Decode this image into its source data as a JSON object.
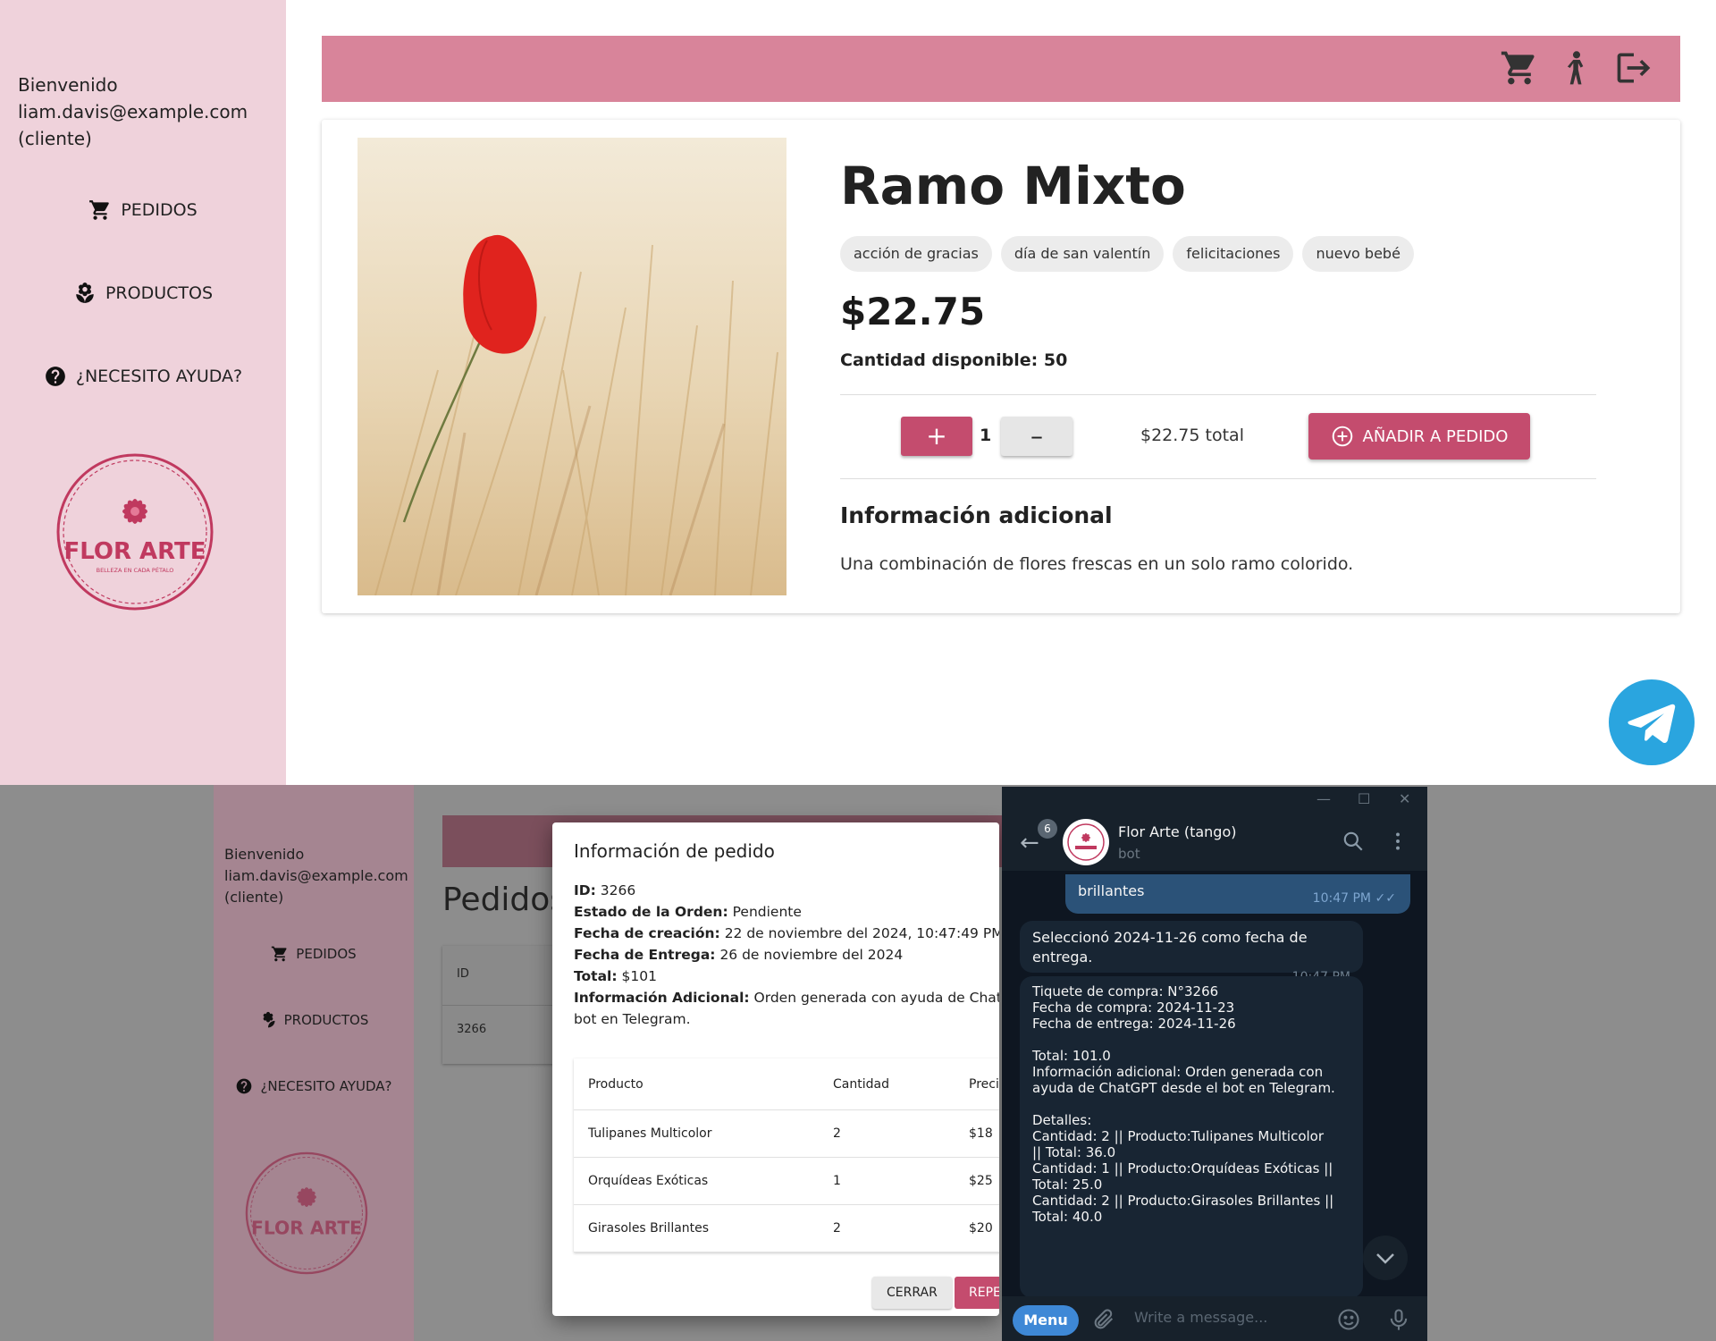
{
  "sidebar": {
    "welcome_line1": "Bienvenido",
    "welcome_email": "liam.davis@example.com",
    "welcome_role": "(cliente)",
    "items": [
      {
        "label": "PEDIDOS",
        "icon": "cart-icon"
      },
      {
        "label": "PRODUCTOS",
        "icon": "flower-icon"
      },
      {
        "label": "¿NECESITO AYUDA?",
        "icon": "help-icon"
      }
    ],
    "logo_text": "FLOR ARTE",
    "logo_tagline": "BELLEZA EN CADA PÉTALO"
  },
  "topbar": {
    "icons": [
      "cart-icon",
      "person-icon",
      "logout-icon"
    ]
  },
  "product": {
    "title": "Ramo Mixto",
    "tags": [
      "acción de gracias",
      "día de san valentín",
      "felicitaciones",
      "nuevo bebé"
    ],
    "price": "$22.75",
    "stock_label": "Cantidad disponible: 50",
    "quantity": "1",
    "plus_label": "+",
    "minus_label": "–",
    "total": "$22.75 total",
    "add_button": "AÑADIR A PEDIDO",
    "info_title": "Información adicional",
    "info_text": "Una combinación de flores frescas en un solo ramo colorido."
  },
  "colors": {
    "sidebar": "#efd2db",
    "topbar": "#d8849a",
    "accent": "#c44c6e",
    "telegram": "#2aa5df"
  },
  "bottom": {
    "sidebar": {
      "welcome_line1": "Bienvenido",
      "welcome_email": "liam.davis@example.com",
      "welcome_role": "(cliente)",
      "items": [
        "PEDIDOS",
        "PRODUCTOS",
        "¿NECESITO AYUDA?"
      ],
      "logo_text": "FLOR ARTE"
    },
    "page_title": "Pedidos",
    "table": {
      "id_header": "ID",
      "id_value": "3266"
    }
  },
  "modal": {
    "title": "Información de pedido",
    "id_label": "ID:",
    "id_value": "3266",
    "status_label": "Estado de la Orden:",
    "status_value": "Pendiente",
    "created_label": "Fecha de creación:",
    "created_value": "22 de noviembre del 2024, 10:47:49 PM",
    "delivery_label": "Fecha de Entrega:",
    "delivery_value": "26 de noviembre del 2024",
    "total_label": "Total:",
    "total_value": "$101",
    "extra_label": "Información Adicional:",
    "extra_value": "Orden generada con ayuda de ChatGPT",
    "extra_value2": "bot en Telegram.",
    "table": {
      "headers": [
        "Producto",
        "Cantidad",
        "Preci"
      ],
      "rows": [
        [
          "Tulipanes Multicolor",
          "2",
          "$18"
        ],
        [
          "Orquídeas Exóticas",
          "1",
          "$25"
        ],
        [
          "Girasoles Brillantes",
          "2",
          "$20"
        ]
      ]
    },
    "cancel_button": "CERRAR",
    "repeat_button": "REPET"
  },
  "telegram": {
    "chat_name": "Flor Arte (tango)",
    "chat_sub": "bot",
    "unread": "6",
    "msg1_text": "brillantes",
    "msg1_time": "10:47 PM",
    "msg2_text": "Seleccionó 2024-11-26 como fecha de entrega.",
    "msg2_time": "10:47 PM",
    "msg3_lines": [
      "Tiquete de compra: N°3266",
      "Fecha de compra: 2024-11-23",
      "Fecha de entrega: 2024-11-26",
      "",
      "Total: 101.0",
      "Información adicional: Orden generada con",
      "ayuda de ChatGPT desde el bot en Telegram.",
      "",
      "Detalles:",
      "Cantidad: 2 || Producto:Tulipanes Multicolor",
      "|| Total: 36.0",
      "Cantidad: 1 || Producto:Orquídeas Exóticas ||",
      "Total: 25.0",
      "Cantidad: 2 || Producto:Girasoles Brillantes ||",
      "Total: 40.0"
    ],
    "menu_button": "Menu",
    "input_placeholder": "Write a message..."
  }
}
